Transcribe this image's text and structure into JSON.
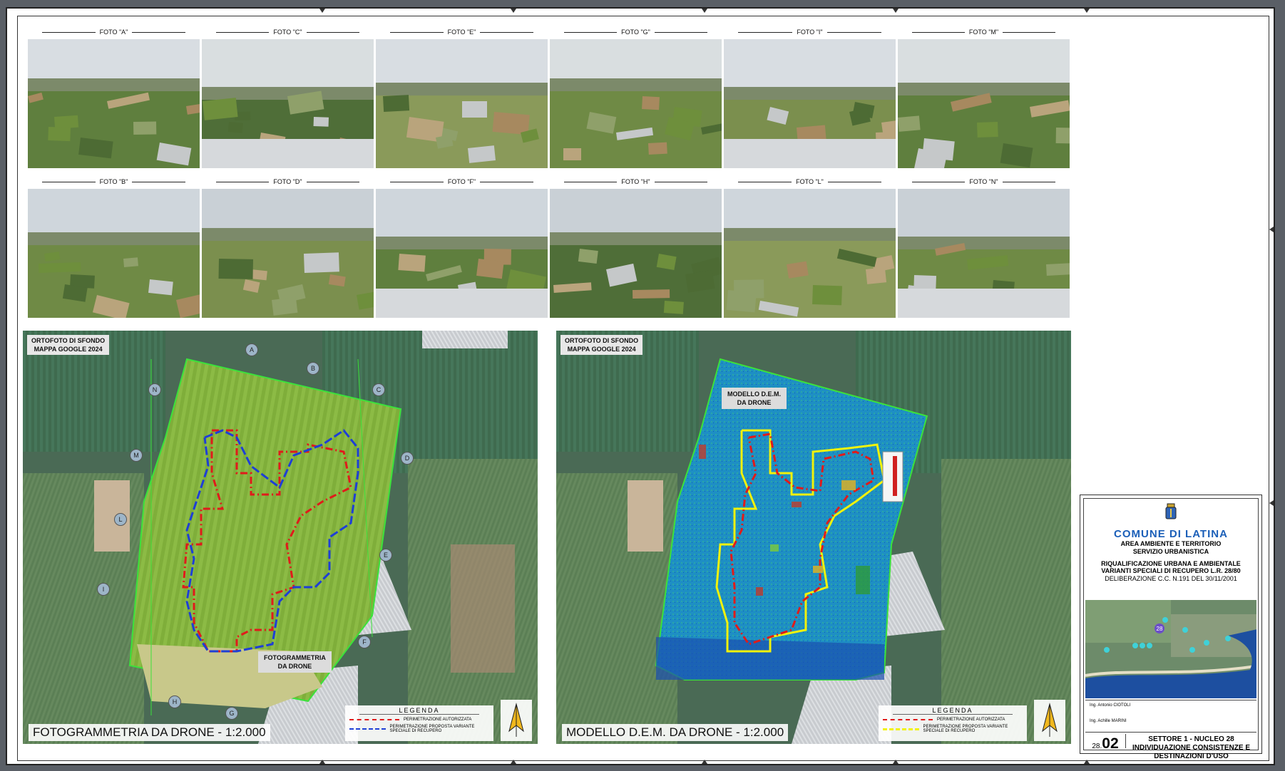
{
  "photos_row1": [
    {
      "label": "FOTO \"A\""
    },
    {
      "label": "FOTO \"C\""
    },
    {
      "label": "FOTO \"E\""
    },
    {
      "label": "FOTO \"G\""
    },
    {
      "label": "FOTO \"I\""
    },
    {
      "label": "FOTO \"M\""
    }
  ],
  "photos_row2": [
    {
      "label": "FOTO \"B\""
    },
    {
      "label": "FOTO \"D\""
    },
    {
      "label": "FOTO \"F\""
    },
    {
      "label": "FOTO \"H\""
    },
    {
      "label": "FOTO \"L\""
    },
    {
      "label": "FOTO \"N\""
    }
  ],
  "map_left": {
    "ortho_line1": "ORTOFOTO DI SFONDO",
    "ortho_line2": "MAPPA GOOGLE 2024",
    "box_line1": "FOTOGRAMMETRIA",
    "box_line2": "DA DRONE",
    "title": "FOTOGRAMMETRIA DA DRONE - 1:2.000",
    "legend_title": "LEGENDA",
    "legend_item1": "PERIMETRAZIONE AUTORIZZATA",
    "legend_item2": "PERIMETRAZIONE PROPOSTA VARIANTE SPECIALE DI RECUPERO",
    "pins": [
      "A",
      "B",
      "C",
      "D",
      "E",
      "F",
      "G",
      "H",
      "I",
      "L",
      "M",
      "N"
    ]
  },
  "map_right": {
    "ortho_line1": "ORTOFOTO DI SFONDO",
    "ortho_line2": "MAPPA GOOGLE 2024",
    "box_line1": "MODELLO D.E.M.",
    "box_line2": "DA DRONE",
    "title": "MODELLO D.E.M. DA DRONE - 1:2.000",
    "legend_title": "LEGENDA",
    "legend_item1": "PERIMETRAZIONE AUTORIZZATA",
    "legend_item2": "PERIMETRAZIONE PROPOSTA VARIANTE SPECIALE DI RECUPERO"
  },
  "titleblock": {
    "comune": "COMUNE DI LATINA",
    "area_line1": "AREA AMBIENTE E TERRITORIO",
    "area_line2": "SERVIZIO URBANISTICA",
    "project_line1": "RIQUALIFICAZIONE URBANA E AMBIENTALE",
    "project_line2": "VARIANTI SPECIALI DI RECUPERO L.R. 28/80",
    "deliberazione": "DELIBERAZIONE C.C. N.191 DEL 30/11/2001",
    "engineer1": "Ing. Antonio CIOTOLI",
    "engineer2": "Ing. Achille MARINI",
    "sheet_prefix": "28.",
    "sheet_number": "02",
    "desc_line1": "SETTORE 1 - NUCLEO 28",
    "desc_line2": "INDIVIDUAZIONE CONSISTENZE E",
    "desc_line3": "DESTINAZIONI D'USO",
    "locator_badge": "28"
  },
  "colors": {
    "perimeter_authorized": "#e01b1b",
    "perimeter_proposed_left": "#1e3fd6",
    "perimeter_proposed_right": "#f2f20a",
    "comune_blue": "#1b5fb8"
  }
}
